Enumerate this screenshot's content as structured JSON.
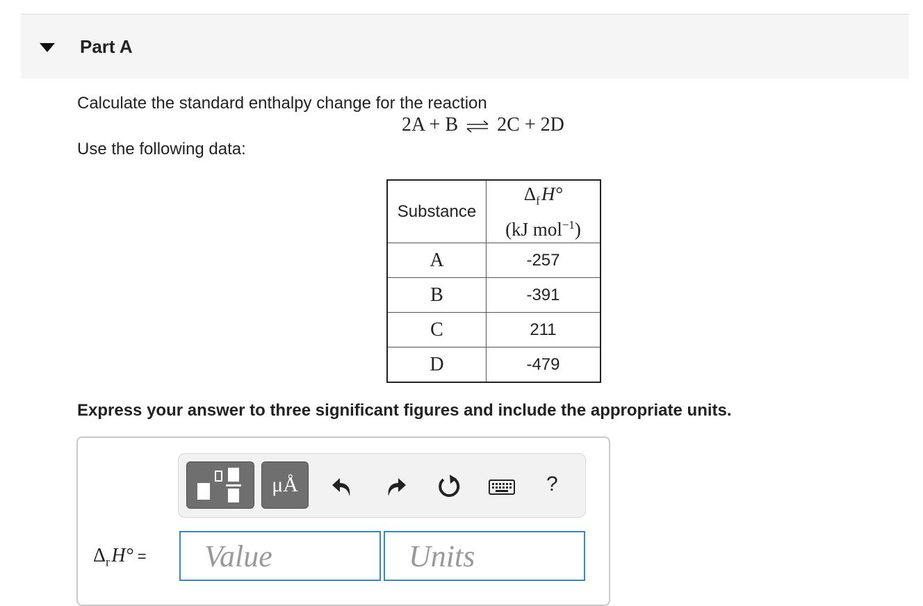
{
  "part": {
    "title": "Part A"
  },
  "prompt": {
    "text": "Calculate the standard enthalpy change for the reaction",
    "reaction_left": "2A + B",
    "reaction_right": "2C + 2D",
    "data_intro": "Use the following data:"
  },
  "table": {
    "header_substance": "Substance",
    "header_quantity": "Δ",
    "header_subscript": "f",
    "header_symbol": "H°",
    "header_units": "(kJ mol",
    "header_units_exp": "−1",
    "header_units_close": ")",
    "rows": [
      {
        "substance": "A",
        "value": "-257"
      },
      {
        "substance": "B",
        "value": "-391"
      },
      {
        "substance": "C",
        "value": "211"
      },
      {
        "substance": "D",
        "value": "-479"
      }
    ]
  },
  "instruction": "Express your answer to three significant figures and include the appropriate units.",
  "toolbar": {
    "units_label": "μÅ",
    "help_label": "?",
    "icons": [
      "templates-icon",
      "units-icon",
      "undo-icon",
      "redo-icon",
      "reset-icon",
      "keyboard-icon",
      "help-icon"
    ]
  },
  "answer": {
    "label_delta": "Δ",
    "label_sub": "r",
    "label_symbol": "H°",
    "label_equals": "=",
    "value_placeholder": "Value",
    "units_placeholder": "Units"
  },
  "colors": {
    "header_bg": "#f5f5f5",
    "input_border": "#3b86b6",
    "tool_button": "#6f6f6f"
  }
}
